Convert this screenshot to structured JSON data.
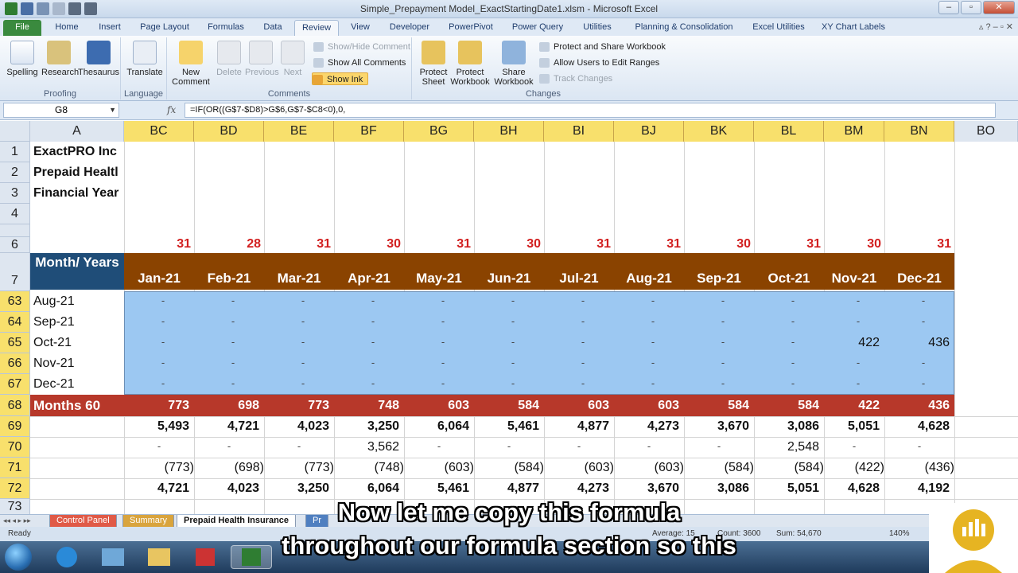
{
  "titlebar": {
    "title": "Simple_Prepayment Model_ExactStartingDate1.xlsm - Microsoft Excel"
  },
  "ribbon_tabs": [
    "File",
    "Home",
    "Insert",
    "Page Layout",
    "Formulas",
    "Data",
    "Review",
    "View",
    "Developer",
    "PowerPivot",
    "Power Query",
    "Utilities",
    "Planning & Consolidation",
    "Excel Utilities",
    "XY Chart Labels"
  ],
  "ribbon": {
    "proofing": {
      "spelling": "Spelling",
      "research": "Research",
      "thesaurus": "Thesaurus",
      "label": "Proofing"
    },
    "language": {
      "translate": "Translate",
      "label": "Language"
    },
    "comments": {
      "new": "New Comment",
      "delete": "Delete",
      "previous": "Previous",
      "next": "Next",
      "show_hide": "Show/Hide Comment",
      "show_all": "Show All Comments",
      "show_ink": "Show Ink",
      "label": "Comments"
    },
    "changes": {
      "protect_sheet": "Protect Sheet",
      "protect_workbook": "Protect Workbook",
      "share_workbook": "Share Workbook",
      "protect_share": "Protect and Share Workbook",
      "allow_edit": "Allow Users to Edit Ranges",
      "track": "Track Changes",
      "label": "Changes"
    }
  },
  "formula_bar": {
    "name_box": "G8",
    "fx": "fx",
    "formula": "=IF(OR((G$7-$D8)>G$6,G$7-$C8<0),0,"
  },
  "columns": [
    "BC",
    "BD",
    "BE",
    "BF",
    "BG",
    "BH",
    "BI",
    "BJ",
    "BK",
    "BL",
    "BM",
    "BN"
  ],
  "col_a": "A",
  "col_bo": "BO",
  "row_numbers": [
    "1",
    "2",
    "3",
    "4",
    "",
    "6",
    "7",
    "63",
    "64",
    "65",
    "66",
    "67",
    "68",
    "69",
    "70",
    "71",
    "72",
    "73"
  ],
  "company": {
    "line1": "ExactPRO Inc",
    "line2": "Prepaid Healtl",
    "line3": "Financial Year"
  },
  "days": [
    "31",
    "28",
    "31",
    "30",
    "31",
    "30",
    "31",
    "31",
    "30",
    "31",
    "30",
    "31"
  ],
  "header": {
    "month_years": "Month/ Years",
    "months": [
      "Jan-21",
      "Feb-21",
      "Mar-21",
      "Apr-21",
      "May-21",
      "Jun-21",
      "Jul-21",
      "Aug-21",
      "Sep-21",
      "Oct-21",
      "Nov-21",
      "Dec-21"
    ]
  },
  "detail_rows": [
    {
      "label": "Aug-21",
      "values": [
        "-",
        "-",
        "-",
        "-",
        "-",
        "-",
        "-",
        "-",
        "-",
        "-",
        "-",
        "-"
      ]
    },
    {
      "label": "Sep-21",
      "values": [
        "-",
        "-",
        "-",
        "-",
        "-",
        "-",
        "-",
        "-",
        "-",
        "-",
        "-",
        "-"
      ]
    },
    {
      "label": "Oct-21",
      "values": [
        "-",
        "-",
        "-",
        "-",
        "-",
        "-",
        "-",
        "-",
        "-",
        "-",
        "422",
        "436"
      ]
    },
    {
      "label": "Nov-21",
      "values": [
        "-",
        "-",
        "-",
        "-",
        "-",
        "-",
        "-",
        "-",
        "-",
        "-",
        "-",
        "-"
      ]
    },
    {
      "label": "Dec-21",
      "values": [
        "-",
        "-",
        "-",
        "-",
        "-",
        "-",
        "-",
        "-",
        "-",
        "-",
        "-",
        "-"
      ]
    }
  ],
  "row68": {
    "label": "Months 60",
    "values": [
      "773",
      "698",
      "773",
      "748",
      "603",
      "584",
      "603",
      "603",
      "584",
      "584",
      "422",
      "436"
    ]
  },
  "row69": [
    "5,493",
    "4,721",
    "4,023",
    "3,250",
    "6,064",
    "5,461",
    "4,877",
    "4,273",
    "3,670",
    "3,086",
    "5,051",
    "4,628"
  ],
  "row70": [
    "-",
    "-",
    "-",
    "3,562",
    "-",
    "-",
    "-",
    "-",
    "-",
    "2,548",
    "-",
    "-"
  ],
  "row71": [
    "(773)",
    "(698)",
    "(773)",
    "(748)",
    "(603)",
    "(584)",
    "(603)",
    "(603)",
    "(584)",
    "(584)",
    "(422)",
    "(436)"
  ],
  "row72": [
    "4,721",
    "4,023",
    "3,250",
    "6,064",
    "5,461",
    "4,877",
    "4,273",
    "3,670",
    "3,086",
    "5,051",
    "4,628",
    "4,192"
  ],
  "sheet_tabs": [
    "Control Panel",
    "Summary",
    "Prepaid Health Insurance",
    "Pr"
  ],
  "status": {
    "ready": "Ready",
    "average": "Average: 15",
    "count": "Count: 3600",
    "sum": "Sum: 54,670",
    "zoom": "140%"
  },
  "caption": {
    "line1": "Now let me copy this formula",
    "line2": "throughout our formula section so this"
  },
  "colors": {
    "header_brown": "#8a4300",
    "total_red": "#b7382a",
    "selection_blue": "#9cc8f2",
    "days_red": "#d21f1f",
    "col_header_yellow": "#f8e06c"
  }
}
